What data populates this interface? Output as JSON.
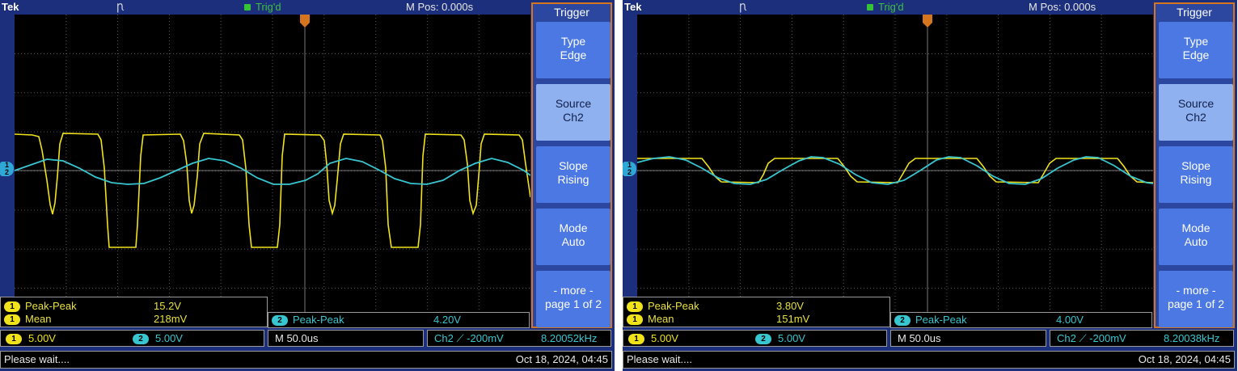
{
  "scopes": [
    {
      "brand": "Tek",
      "pulse_icon": "Ꞃ",
      "trigger_status": "Trig'd",
      "mpos": "M Pos: 0.000s",
      "menu": {
        "title": "Trigger",
        "buttons": [
          {
            "line1": "Type",
            "line2": "Edge"
          },
          {
            "line1": "Source",
            "line2": "Ch2"
          },
          {
            "line1": "Slope",
            "line2": "Rising"
          },
          {
            "line1": "Mode",
            "line2": "Auto"
          },
          {
            "line1": "- more -",
            "line2": "page 1 of 2"
          }
        ]
      },
      "measurements": {
        "ch1": [
          {
            "badge": "1",
            "label": "Peak-Peak",
            "value": "15.2V"
          },
          {
            "badge": "1",
            "label": "Mean",
            "value": "218mV"
          }
        ],
        "ch2": {
          "badge": "2",
          "label": "Peak-Peak",
          "value": "4.20V"
        }
      },
      "status": {
        "ch1_badge": "1",
        "ch1_scale": "5.00V",
        "ch2_badge": "2",
        "ch2_scale": "5.00V",
        "timebase": "M 50.0us",
        "trigger": "Ch2 ⟋ -200mV",
        "frequency": "8.20052kHz"
      },
      "footer": {
        "message": "Please wait....",
        "datetime": "Oct 18, 2024, 04:45"
      },
      "marker": {
        "ch1": "1",
        "ch2": "2"
      },
      "colors": {
        "ch1": "#f0e31c",
        "ch2": "#38c6d0",
        "accent": "#d57520"
      }
    },
    {
      "brand": "Tek",
      "pulse_icon": "Ꞃ",
      "trigger_status": "Trig'd",
      "mpos": "M Pos: 0.000s",
      "menu": {
        "title": "Trigger",
        "buttons": [
          {
            "line1": "Type",
            "line2": "Edge"
          },
          {
            "line1": "Source",
            "line2": "Ch2"
          },
          {
            "line1": "Slope",
            "line2": "Rising"
          },
          {
            "line1": "Mode",
            "line2": "Auto"
          },
          {
            "line1": "- more -",
            "line2": "page 1 of 2"
          }
        ]
      },
      "measurements": {
        "ch1": [
          {
            "badge": "1",
            "label": "Peak-Peak",
            "value": "3.80V"
          },
          {
            "badge": "1",
            "label": "Mean",
            "value": "151mV"
          }
        ],
        "ch2": {
          "badge": "2",
          "label": "Peak-Peak",
          "value": "4.00V"
        }
      },
      "status": {
        "ch1_badge": "1",
        "ch1_scale": "5.00V",
        "ch2_badge": "2",
        "ch2_scale": "5.00V",
        "timebase": "M 50.0us",
        "trigger": "Ch2 ⟋ -200mV",
        "frequency": "8.20038kHz"
      },
      "footer": {
        "message": "Please wait....",
        "datetime": "Oct 18, 2024, 04:45"
      },
      "marker": {
        "ch1": "1",
        "ch2": "2"
      },
      "colors": {
        "ch1": "#f0e31c",
        "ch2": "#38c6d0",
        "accent": "#d57520"
      }
    }
  ]
}
